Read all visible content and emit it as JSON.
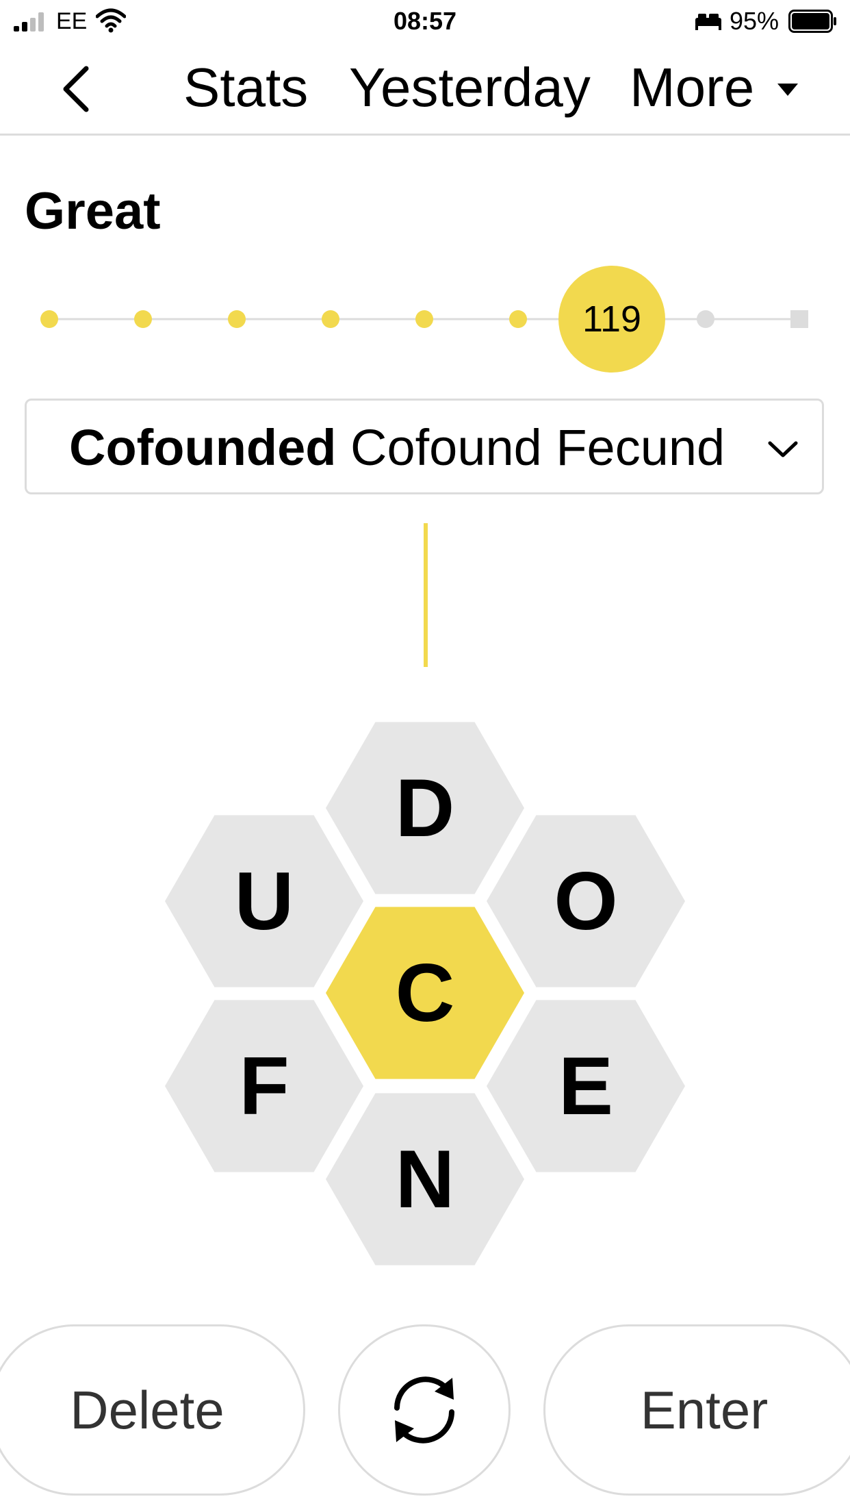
{
  "status_bar": {
    "carrier": "EE",
    "time": "08:57",
    "battery_percent": "95%",
    "signal_bars": 2,
    "icons": [
      "signal-icon",
      "wifi-icon",
      "bed-icon",
      "battery-icon"
    ]
  },
  "nav": {
    "back_icon": "chevron-left-icon",
    "stats_label": "Stats",
    "yesterday_label": "Yesterday",
    "more_label": "More",
    "more_icon": "caret-down-icon"
  },
  "rank": {
    "title": "Great",
    "score": "119",
    "current_step": 6,
    "total_steps": 9
  },
  "found_words": {
    "first": "Cofounded",
    "rest": "Cofound Fecund",
    "toggle_icon": "chevron-down-icon"
  },
  "hive": {
    "center": "C",
    "outer": {
      "top": "D",
      "upper_left": "U",
      "upper_right": "O",
      "lower_left": "F",
      "lower_right": "E",
      "bottom": "N"
    }
  },
  "controls": {
    "delete_label": "Delete",
    "shuffle_icon": "shuffle-icon",
    "enter_label": "Enter"
  },
  "colors": {
    "accent_yellow": "#f2d94e",
    "cell_gray": "#e6e6e6",
    "divider": "#dcdcdc",
    "inactive_dot": "#dcdcdc"
  }
}
